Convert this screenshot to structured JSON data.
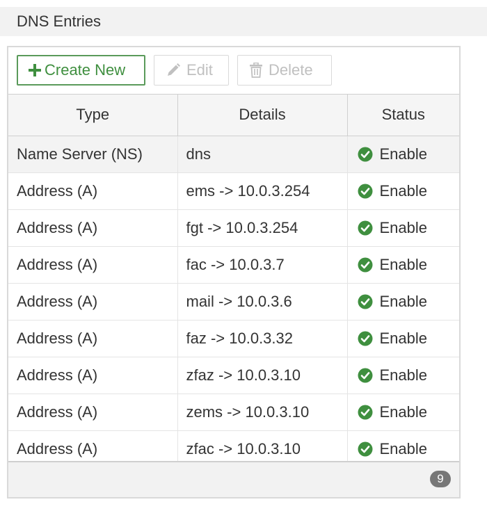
{
  "section": {
    "title": "DNS Entries"
  },
  "toolbar": {
    "create_label": "Create New",
    "edit_label": "Edit",
    "delete_label": "Delete"
  },
  "table": {
    "columns": [
      "Type",
      "Details",
      "Status"
    ],
    "rows": [
      {
        "type": "Name Server (NS)",
        "details": "dns",
        "status": "Enable"
      },
      {
        "type": "Address (A)",
        "details": "ems -> 10.0.3.254",
        "status": "Enable"
      },
      {
        "type": "Address (A)",
        "details": "fgt -> 10.0.3.254",
        "status": "Enable"
      },
      {
        "type": "Address (A)",
        "details": "fac -> 10.0.3.7",
        "status": "Enable"
      },
      {
        "type": "Address (A)",
        "details": "mail -> 10.0.3.6",
        "status": "Enable"
      },
      {
        "type": "Address (A)",
        "details": "faz -> 10.0.3.32",
        "status": "Enable"
      },
      {
        "type": "Address (A)",
        "details": "zfaz -> 10.0.3.10",
        "status": "Enable"
      },
      {
        "type": "Address (A)",
        "details": "zems -> 10.0.3.10",
        "status": "Enable"
      },
      {
        "type": "Address (A)",
        "details": "zfac -> 10.0.3.10",
        "status": "Enable"
      }
    ]
  },
  "footer": {
    "count": "9"
  },
  "colors": {
    "enable_green": "#3f8f3f",
    "create_border": "#5a9a5a",
    "badge": "#777777"
  },
  "icons": {
    "create": "plus-icon",
    "edit": "pencil-icon",
    "delete": "trash-icon",
    "status": "check-circle-icon"
  }
}
